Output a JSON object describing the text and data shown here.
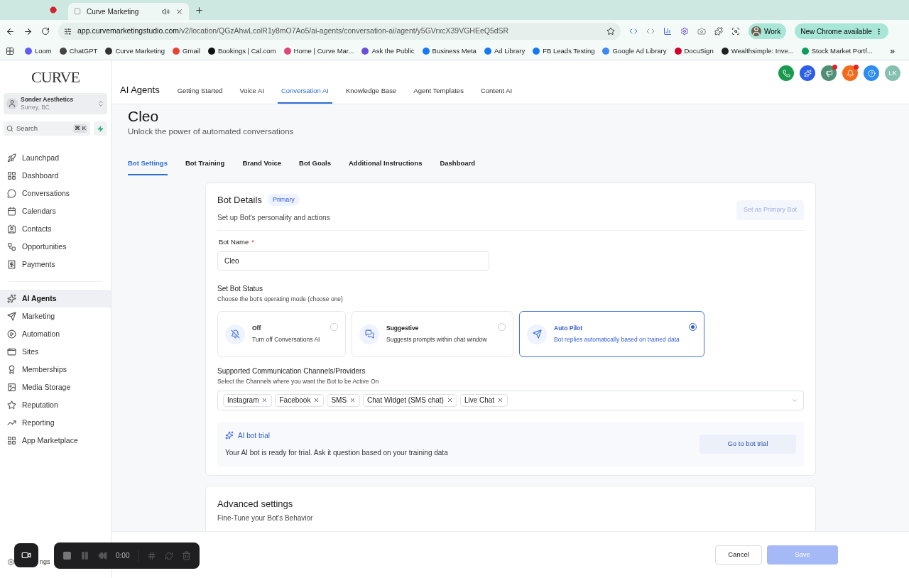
{
  "browser": {
    "tab_title": "Curve Marketing",
    "url_host": "app.curvemarketingstudio.com",
    "url_path": "/v2/location/QGzAhwLcolR1y8mO7Ao5/ai-agents/conversation-ai/agent/y5GVrxcX39VGHEeQ5dSR",
    "profile": "Work",
    "update_button": "New Chrome available",
    "bookmarks": [
      {
        "label": "Loom",
        "color": "#625df5"
      },
      {
        "label": "ChatGPT",
        "color": "#444444"
      },
      {
        "label": "Curve Marketing",
        "color": "#333333"
      },
      {
        "label": "Gmail",
        "color": "#ea4335"
      },
      {
        "label": "Bookings | Cal.com",
        "color": "#111111"
      },
      {
        "label": "Home | Curve Mar...",
        "color": "#e0457b"
      },
      {
        "label": "Ask the Public",
        "color": "#6b4fd8"
      },
      {
        "label": "Business Meta",
        "color": "#1877f2"
      },
      {
        "label": "Ad Library",
        "color": "#1877f2"
      },
      {
        "label": "FB Leads Testing",
        "color": "#1877f2"
      },
      {
        "label": "Google Ad Library",
        "color": "#4285f4"
      },
      {
        "label": "DocuSign",
        "color": "#d4002a"
      },
      {
        "label": "Wealthsimple: Inve...",
        "color": "#222222"
      },
      {
        "label": "Stock Market Portf...",
        "color": "#0f9d58"
      }
    ],
    "more": "»"
  },
  "sidebar": {
    "brand": "CURVE",
    "account": {
      "name": "Sonder Aesthetics",
      "location": "Surrey, BC"
    },
    "search": {
      "placeholder": "Search",
      "shortcut": "⌘ K"
    },
    "primary_items": [
      {
        "label": "Launchpad",
        "selected": false
      },
      {
        "label": "Dashboard",
        "selected": false
      },
      {
        "label": "Conversations",
        "selected": false
      },
      {
        "label": "Calendars",
        "selected": false
      },
      {
        "label": "Contacts",
        "selected": false
      },
      {
        "label": "Opportunities",
        "selected": false
      },
      {
        "label": "Payments",
        "selected": false
      }
    ],
    "secondary_items": [
      {
        "label": "AI Agents",
        "selected": true
      },
      {
        "label": "Marketing",
        "selected": false
      },
      {
        "label": "Automation",
        "selected": false
      },
      {
        "label": "Sites",
        "selected": false
      },
      {
        "label": "Memberships",
        "selected": false
      },
      {
        "label": "Media Storage",
        "selected": false
      },
      {
        "label": "Reputation",
        "selected": false
      },
      {
        "label": "Reporting",
        "selected": false
      },
      {
        "label": "App Marketplace",
        "selected": false
      }
    ],
    "settings_partial": "ngs"
  },
  "header": {
    "section": "AI Agents",
    "tabs": [
      {
        "label": "Getting Started",
        "selected": false
      },
      {
        "label": "Voice AI",
        "selected": false
      },
      {
        "label": "Conversation AI",
        "selected": true
      },
      {
        "label": "Knowledge Base",
        "selected": false
      },
      {
        "label": "Agent Templates",
        "selected": false
      },
      {
        "label": "Content AI",
        "selected": false
      }
    ],
    "actions": [
      {
        "color": "#1a9a4e",
        "badge": false
      },
      {
        "color": "#2c5ee8",
        "badge": false
      },
      {
        "color": "#4f8f78",
        "badge": true
      },
      {
        "color": "#f26b1d",
        "badge": true
      },
      {
        "color": "#2d8cf0",
        "badge": false
      }
    ],
    "avatar": "LK"
  },
  "page": {
    "title": "Cleo",
    "subtitle": "Unlock the power of automated conversations",
    "tabs": [
      {
        "label": "Bot Settings",
        "selected": true
      },
      {
        "label": "Bot Training",
        "selected": false
      },
      {
        "label": "Brand Voice",
        "selected": false
      },
      {
        "label": "Bot Goals",
        "selected": false
      },
      {
        "label": "Additional Instructions",
        "selected": false
      },
      {
        "label": "Dashboard",
        "selected": false
      }
    ]
  },
  "bot_details": {
    "title": "Bot Details",
    "badge": "Primary",
    "subtitle": "Set up Bot's personality and actions",
    "primary_button": {
      "label": "Set as Primary Bot",
      "disabled": true
    },
    "name_label": "Bot Name",
    "required_mark": "*",
    "name_value": "Cleo",
    "status_title": "Set Bot Status",
    "status_hint": "Choose the bot's operating mode (choose one)",
    "statuses": [
      {
        "title": "Off",
        "description": "Turn off Conversations AI",
        "selected": false
      },
      {
        "title": "Suggestive",
        "description": "Suggests prompts within chat window",
        "selected": false
      },
      {
        "title": "Auto Pilot",
        "description": "Bot replies automatically based on trained data",
        "selected": true
      }
    ],
    "channels_title": "Supported Communication Channels/Providers",
    "channels_hint": "Select the Channels where you want the Bot to be Active On",
    "channels": [
      "Instagram",
      "Facebook",
      "SMS",
      "Chat Widget (SMS chat)",
      "Live Chat"
    ],
    "trial": {
      "title": "AI bot trial",
      "text": "Your AI bot is ready for trial. Ask it question based on your training data",
      "button": "Go to bot trial"
    }
  },
  "advanced": {
    "title": "Advanced settings",
    "subtitle": "Fine-Tune your Bot's Behavior"
  },
  "footer": {
    "cancel": "Cancel",
    "save": {
      "label": "Save",
      "disabled": true
    }
  },
  "recorder": {
    "time": "0:00"
  }
}
